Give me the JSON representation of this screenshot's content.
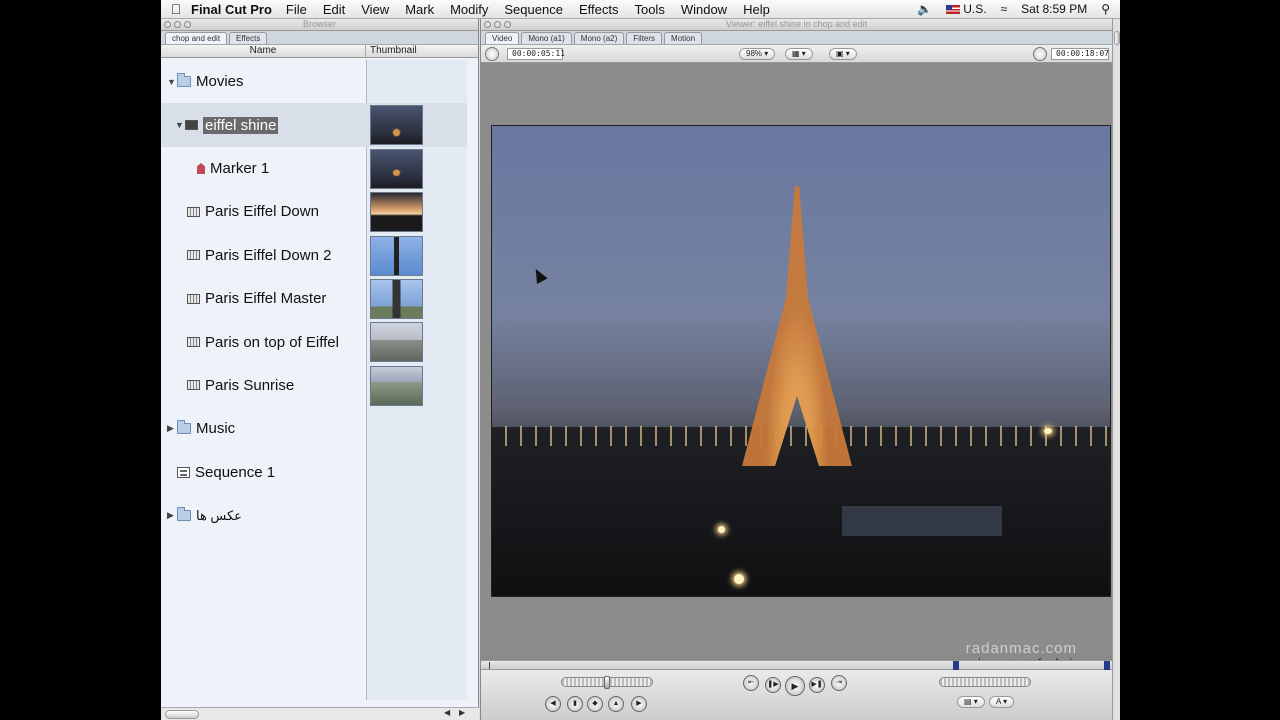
{
  "menubar": {
    "app_name": "Final Cut Pro",
    "items": [
      "File",
      "Edit",
      "View",
      "Mark",
      "Modify",
      "Sequence",
      "Effects",
      "Tools",
      "Window",
      "Help"
    ],
    "locale": "U.S.",
    "clock": "Sat 8:59 PM"
  },
  "browser": {
    "title": "Browser",
    "tabs": [
      "chop and edit",
      "Effects"
    ],
    "columns": {
      "name": "Name",
      "thumbnail": "Thumbnail"
    },
    "rows": [
      {
        "label": "Movies",
        "type": "folder",
        "expanded": true
      },
      {
        "label": "eiffel shine",
        "type": "clip",
        "expanded": true,
        "selected": true
      },
      {
        "label": "Marker 1",
        "type": "marker"
      },
      {
        "label": "Paris Eiffel Down",
        "type": "clip"
      },
      {
        "label": "Paris Eiffel Down 2",
        "type": "clip"
      },
      {
        "label": "Paris Eiffel Master",
        "type": "clip"
      },
      {
        "label": "Paris on top of Eiffel",
        "type": "clip"
      },
      {
        "label": "Paris Sunrise",
        "type": "clip"
      },
      {
        "label": "Music",
        "type": "folder",
        "expanded": false
      },
      {
        "label": "Sequence 1",
        "type": "sequence"
      },
      {
        "label": "عکس ها",
        "type": "folder",
        "expanded": false
      }
    ]
  },
  "viewer": {
    "title": "Viewer: eiffel shine in chop and edit",
    "tabs": [
      "Video",
      "Mono (a1)",
      "Mono (a2)",
      "Filters",
      "Motion"
    ],
    "duration_tc": "00:00:05:11",
    "current_tc": "00:00:18:07",
    "zoom": "98%"
  },
  "watermark": {
    "brand": "radanmac.com",
    "subtitle": "مرکز فروش و خدمات Apple"
  }
}
